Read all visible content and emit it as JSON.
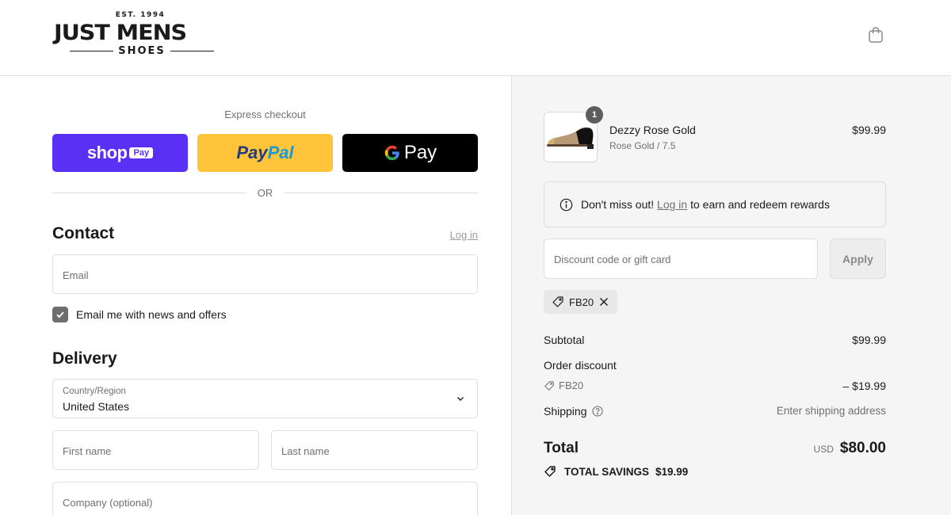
{
  "brand": {
    "est": "EST. 1994",
    "name": "JUST MENS",
    "sub": "SHOES"
  },
  "header": {
    "cart_icon": "shopping-bag-icon"
  },
  "express": {
    "label": "Express checkout",
    "shop_pay": {
      "word": "shop",
      "badge": "Pay"
    },
    "paypal": {
      "part1": "Pay",
      "part2": "Pal"
    },
    "google_pay": {
      "word": "Pay"
    },
    "or_label": "OR"
  },
  "contact": {
    "title": "Contact",
    "login_link": "Log in",
    "email_placeholder": "Email",
    "newsletter_label": "Email me with news and offers",
    "newsletter_checked": true
  },
  "delivery": {
    "title": "Delivery",
    "country_label": "Country/Region",
    "country_value": "United States",
    "first_name_placeholder": "First name",
    "last_name_placeholder": "Last name",
    "company_placeholder": "Company (optional)"
  },
  "cart": {
    "item": {
      "quantity": "1",
      "name": "Dezzy Rose Gold",
      "variant": "Rose Gold / 7.5",
      "price": "$99.99"
    }
  },
  "rewards": {
    "prefix": "Don't miss out!",
    "link": "Log in",
    "suffix": "to earn and redeem rewards"
  },
  "discount": {
    "placeholder": "Discount code or gift card",
    "apply_label": "Apply",
    "applied_code": "FB20"
  },
  "summary": {
    "subtotal_label": "Subtotal",
    "subtotal_value": "$99.99",
    "order_discount_label": "Order discount",
    "discount_code": "FB20",
    "discount_value": "– $19.99",
    "shipping_label": "Shipping",
    "shipping_value": "Enter shipping address",
    "total_label": "Total",
    "currency": "USD",
    "total_value": "$80.00",
    "savings_label": "TOTAL SAVINGS",
    "savings_value": "$19.99"
  },
  "colors": {
    "shop_pay": "#5a31f4",
    "paypal": "#ffc43a",
    "google_pay": "#000000",
    "summary_bg": "#f5f5f5"
  }
}
